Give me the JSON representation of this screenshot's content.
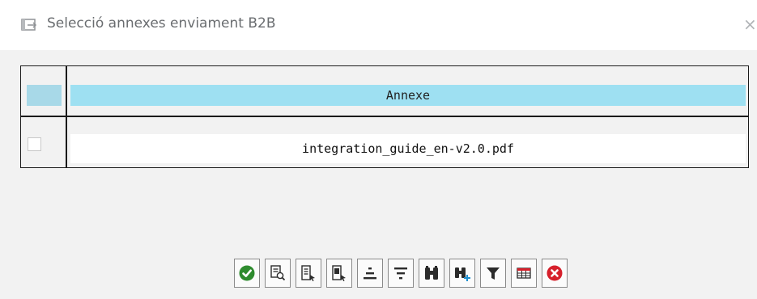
{
  "window": {
    "title": "Selecció annexes enviament B2B",
    "close_glyph": "×"
  },
  "table": {
    "columns": [
      "Annexe"
    ],
    "rows": [
      {
        "annexe": "integration_guide_en-v2.0.pdf",
        "selected": false
      }
    ]
  },
  "toolbar": {
    "buttons": [
      {
        "icon": "check-circle-icon",
        "action": "confirm"
      },
      {
        "icon": "details-icon",
        "action": "details"
      },
      {
        "icon": "select-all-icon",
        "action": "select-all"
      },
      {
        "icon": "deselect-all-icon",
        "action": "deselect-all"
      },
      {
        "icon": "sort-ascending-icon",
        "action": "sort-ascending"
      },
      {
        "icon": "sort-descending-icon",
        "action": "sort-descending"
      },
      {
        "icon": "find-icon",
        "action": "find"
      },
      {
        "icon": "find-next-icon",
        "action": "find-next"
      },
      {
        "icon": "filter-icon",
        "action": "filter"
      },
      {
        "icon": "layout-icon",
        "action": "layout"
      },
      {
        "icon": "cancel-icon",
        "action": "cancel"
      }
    ]
  },
  "colors": {
    "header_bg": "#9ee0f2",
    "confirm_green": "#2e8b2e",
    "cancel_red": "#d6202b",
    "icon_dark": "#2b2b2b"
  }
}
